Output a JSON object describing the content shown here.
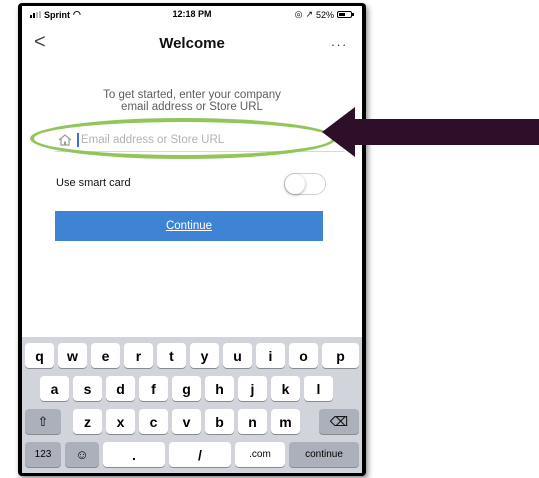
{
  "status_bar": {
    "carrier": "Sprint",
    "time": "12:18 PM",
    "battery_text": "52%",
    "icons": [
      "signal-icon",
      "wifi-icon",
      "location-icon",
      "battery-icon"
    ]
  },
  "nav": {
    "title": "Welcome",
    "back_glyph": "<",
    "more_glyph": "..."
  },
  "instructions": {
    "line1": "To get started, enter your company",
    "line2": "email address or Store URL"
  },
  "email_field": {
    "placeholder": "Email address or Store URL",
    "value": "",
    "icon": "house-icon"
  },
  "smart_card": {
    "label": "Use smart card",
    "enabled": false
  },
  "continue_label": "Continue",
  "keyboard": {
    "row1": [
      "q",
      "w",
      "e",
      "r",
      "t",
      "y",
      "u",
      "i",
      "o",
      "p"
    ],
    "row2": [
      "a",
      "s",
      "d",
      "f",
      "g",
      "h",
      "j",
      "k",
      "l"
    ],
    "row3": [
      "z",
      "x",
      "c",
      "v",
      "b",
      "n",
      "m"
    ],
    "bottom": {
      "numbers": "123",
      "dot": ".",
      "slash": "/",
      "dotcom": ".com",
      "submit": "continue"
    }
  },
  "colors": {
    "accent_button": "#3f83d4",
    "highlight_ellipse": "#92c65a",
    "arrow": "#2d0f2a"
  }
}
